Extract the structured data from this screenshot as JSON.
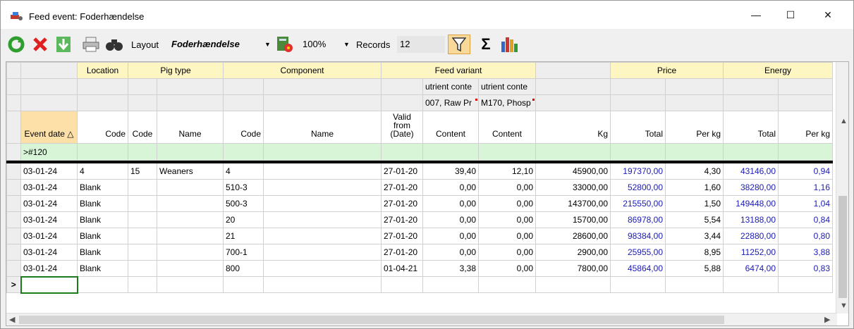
{
  "window": {
    "title": "Feed event: Foderhændelse",
    "minimize": "—",
    "maximize": "☐",
    "close": "✕"
  },
  "toolbar": {
    "layout_label": "Layout",
    "layout_value": "Foderhændelse",
    "zoom_value": "100%",
    "records_label": "Records",
    "records_value": "12"
  },
  "grid": {
    "groups": {
      "location": "Location",
      "pig_type": "Pig type",
      "component": "Component",
      "feed_variant": "Feed variant",
      "price": "Price",
      "energy": "Energy"
    },
    "nutrient": {
      "col1_line1": "utrient conte",
      "col1_line2": "007, Raw Pr",
      "col2_line1": "utrient conte",
      "col2_line2": "M170, Phosp"
    },
    "columns": {
      "event_date": "Event date",
      "loc_code": "Code",
      "pig_code": "Code",
      "pig_name": "Name",
      "comp_code": "Code",
      "comp_name": "Name",
      "valid_from": "Valid from (Date)",
      "content1": "Content",
      "content2": "Content",
      "kg": "Kg",
      "price_total": "Total",
      "price_perkg": "Per kg",
      "energy_total": "Total",
      "energy_perkg": "Per kg"
    },
    "filter_text": ">#120",
    "new_row_marker": ">",
    "rows": [
      {
        "date": "03-01-24",
        "loc": "4",
        "pig_code": "15",
        "pig_name": "Weaners",
        "comp": "4",
        "valid": "27-01-20",
        "c1": "39,40",
        "c2": "12,10",
        "kg": "45900,00",
        "pt": "197370,00",
        "pk": "4,30",
        "et": "43146,00",
        "ek": "0,94"
      },
      {
        "date": "03-01-24",
        "loc": "Blank",
        "pig_code": "",
        "pig_name": "",
        "comp": "510-3",
        "valid": "27-01-20",
        "c1": "0,00",
        "c2": "0,00",
        "kg": "33000,00",
        "pt": "52800,00",
        "pk": "1,60",
        "et": "38280,00",
        "ek": "1,16"
      },
      {
        "date": "03-01-24",
        "loc": "Blank",
        "pig_code": "",
        "pig_name": "",
        "comp": "500-3",
        "valid": "27-01-20",
        "c1": "0,00",
        "c2": "0,00",
        "kg": "143700,00",
        "pt": "215550,00",
        "pk": "1,50",
        "et": "149448,00",
        "ek": "1,04"
      },
      {
        "date": "03-01-24",
        "loc": "Blank",
        "pig_code": "",
        "pig_name": "",
        "comp": "20",
        "valid": "27-01-20",
        "c1": "0,00",
        "c2": "0,00",
        "kg": "15700,00",
        "pt": "86978,00",
        "pk": "5,54",
        "et": "13188,00",
        "ek": "0,84"
      },
      {
        "date": "03-01-24",
        "loc": "Blank",
        "pig_code": "",
        "pig_name": "",
        "comp": "21",
        "valid": "27-01-20",
        "c1": "0,00",
        "c2": "0,00",
        "kg": "28600,00",
        "pt": "98384,00",
        "pk": "3,44",
        "et": "22880,00",
        "ek": "0,80"
      },
      {
        "date": "03-01-24",
        "loc": "Blank",
        "pig_code": "",
        "pig_name": "",
        "comp": "700-1",
        "valid": "27-01-20",
        "c1": "0,00",
        "c2": "0,00",
        "kg": "2900,00",
        "pt": "25955,00",
        "pk": "8,95",
        "et": "11252,00",
        "ek": "3,88"
      },
      {
        "date": "03-01-24",
        "loc": "Blank",
        "pig_code": "",
        "pig_name": "",
        "comp": "800",
        "valid": "01-04-21",
        "c1": "3,38",
        "c2": "0,00",
        "kg": "7800,00",
        "pt": "45864,00",
        "pk": "5,88",
        "et": "6474,00",
        "ek": "0,83"
      }
    ]
  }
}
